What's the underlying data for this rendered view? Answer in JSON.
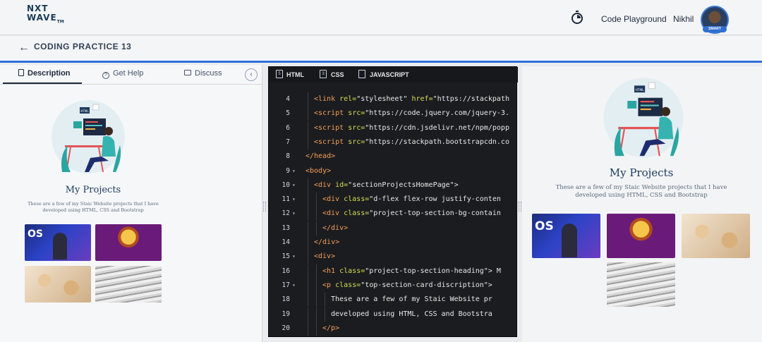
{
  "brand": {
    "line1": "NXT",
    "line2": "WAVE",
    "tm": "TM"
  },
  "header": {
    "code_playground": "Code Playground",
    "user_name": "Nikhil",
    "avatar_badge": "SMART"
  },
  "subheader": {
    "title": "CODING PRACTICE 13"
  },
  "left_tabs": [
    {
      "label": "Description"
    },
    {
      "label": "Get Help"
    },
    {
      "label": "Discuss"
    }
  ],
  "editor_tabs": [
    {
      "label": "HTML",
      "icon": "html5-icon"
    },
    {
      "label": "CSS",
      "icon": "css3-icon"
    },
    {
      "label": "JAVASCRIPT",
      "icon": "js-file-icon"
    }
  ],
  "code_lines": [
    {
      "n": "4",
      "fold": "",
      "indent": 0,
      "parts": [
        [
          "t",
          "<link "
        ],
        [
          "a",
          "rel="
        ],
        [
          "s",
          "\"stylesheet\" "
        ],
        [
          "a",
          "href="
        ],
        [
          "s",
          "\"https://stackpath"
        ]
      ]
    },
    {
      "n": "5",
      "fold": "",
      "indent": 0,
      "parts": [
        [
          "t",
          "<script "
        ],
        [
          "a",
          "src="
        ],
        [
          "s",
          "\"https://code.jquery.com/jquery-3."
        ]
      ]
    },
    {
      "n": "6",
      "fold": "",
      "indent": 0,
      "parts": [
        [
          "t",
          "<script "
        ],
        [
          "a",
          "src="
        ],
        [
          "s",
          "\"https://cdn.jsdelivr.net/npm/popp"
        ]
      ]
    },
    {
      "n": "7",
      "fold": "",
      "indent": 0,
      "parts": [
        [
          "t",
          "<script "
        ],
        [
          "a",
          "src="
        ],
        [
          "s",
          "\"https://stackpath.bootstrapcdn.co"
        ]
      ]
    },
    {
      "n": "8",
      "fold": "",
      "indent": -1,
      "parts": [
        [
          "t",
          "</head>"
        ]
      ]
    },
    {
      "n": "9",
      "fold": "▾",
      "indent": -1,
      "parts": [
        [
          "t",
          "<body>"
        ]
      ]
    },
    {
      "n": "10",
      "fold": "▾",
      "indent": 0,
      "parts": [
        [
          "t",
          "<div "
        ],
        [
          "a",
          "id="
        ],
        [
          "s",
          "\"sectionProjectsHomePage\">"
        ]
      ]
    },
    {
      "n": "11",
      "fold": "▾",
      "indent": 1,
      "parts": [
        [
          "t",
          "<div "
        ],
        [
          "a",
          "class="
        ],
        [
          "s",
          "\"d-flex flex-row justify-conten"
        ]
      ]
    },
    {
      "n": "12",
      "fold": "▾",
      "indent": 1,
      "parts": [
        [
          "t",
          "<div "
        ],
        [
          "a",
          "class="
        ],
        [
          "s",
          "\"project-top-section-bg-contain"
        ]
      ]
    },
    {
      "n": "13",
      "fold": "",
      "indent": 1,
      "parts": [
        [
          "t",
          "</div>"
        ]
      ]
    },
    {
      "n": "14",
      "fold": "",
      "indent": 0,
      "parts": [
        [
          "t",
          "</div>"
        ]
      ]
    },
    {
      "n": "15",
      "fold": "▾",
      "indent": 0,
      "parts": [
        [
          "t",
          "<div>"
        ]
      ]
    },
    {
      "n": "16",
      "fold": "",
      "indent": 1,
      "parts": [
        [
          "t",
          "<h1 "
        ],
        [
          "a",
          "class="
        ],
        [
          "s",
          "\"project-top-section-heading\"> M"
        ]
      ]
    },
    {
      "n": "17",
      "fold": "▾",
      "indent": 1,
      "parts": [
        [
          "t",
          "<p "
        ],
        [
          "a",
          "class="
        ],
        [
          "s",
          "\"top-section-card-discription\">"
        ]
      ]
    },
    {
      "n": "18",
      "fold": "",
      "indent": 2,
      "parts": [
        [
          "x",
          "These are a few of my Staic Website pr"
        ]
      ]
    },
    {
      "n": "19",
      "fold": "",
      "indent": 2,
      "parts": [
        [
          "x",
          "developed using HTML, CSS and Bootstra"
        ]
      ]
    },
    {
      "n": "20",
      "fold": "",
      "indent": 1,
      "parts": [
        [
          "t",
          "</p>"
        ]
      ]
    }
  ],
  "project_section": {
    "title": "My Projects",
    "description_left_1": "These are a few of my Staic Website projects that I have",
    "description_left_2": "developed using HTML, CSS and Bootstrap",
    "description_right_1": "These are a few of my Staic Website projects that I have",
    "description_right_2": "developed using HTML, CSS and Bootstrap",
    "thumb_1_text": "OS",
    "illus_html_label": "HTML"
  }
}
